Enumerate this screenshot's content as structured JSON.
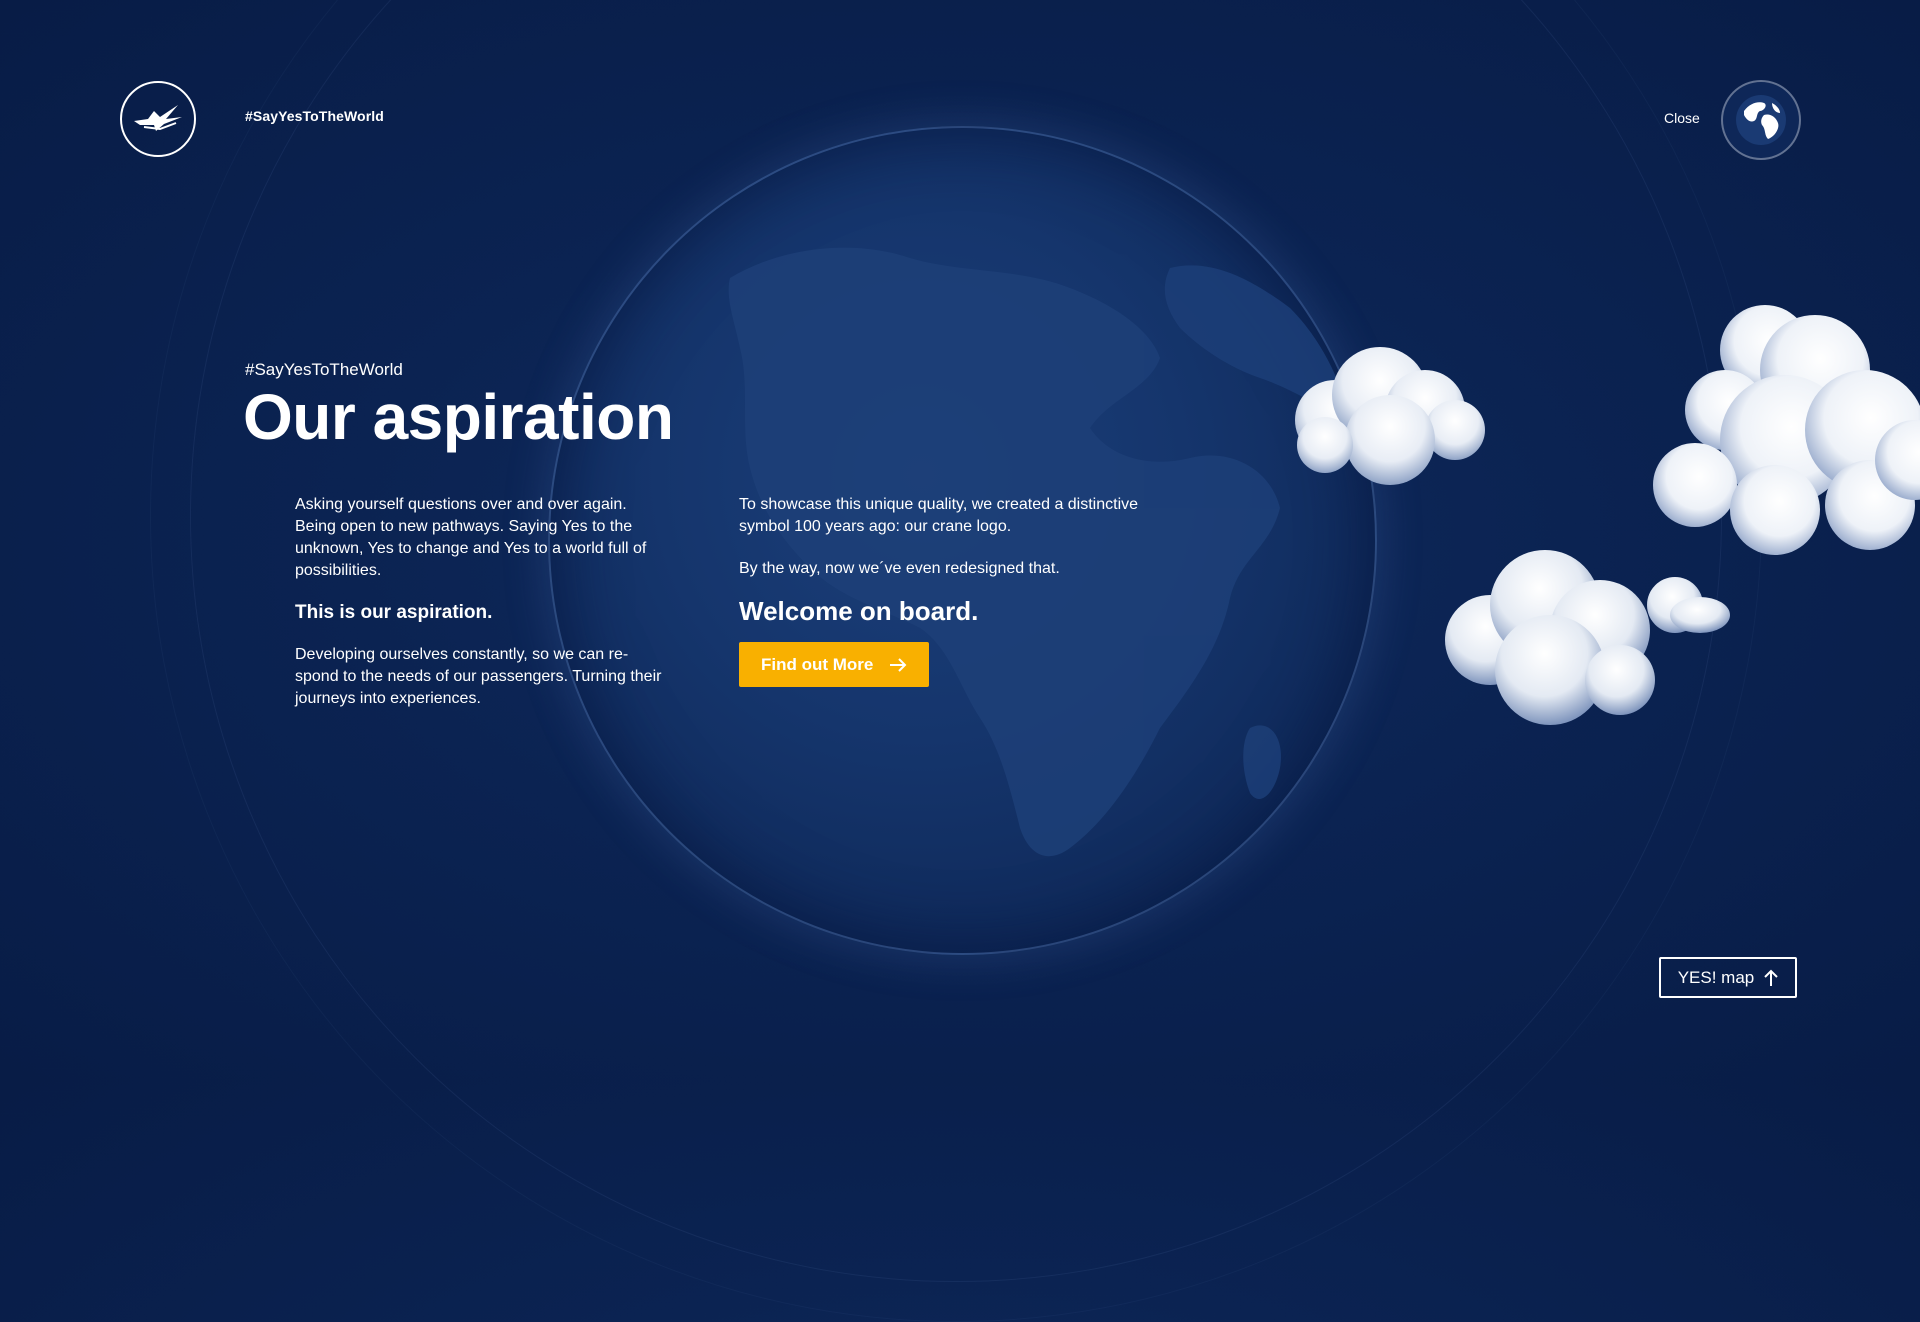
{
  "header": {
    "hashtag": "#SayYesToTheWorld",
    "close_label": "Close"
  },
  "hero": {
    "eyebrow": "#SayYesToTheWorld",
    "title": "Our aspiration"
  },
  "column_left": {
    "paragraph1": "Asking yourself questions over and over again. Being open to new pathways.  Saying Yes to the unknown, Yes to change and Yes to a world full of possibilities.",
    "emphasis": "This is our aspiration.",
    "paragraph2": "Developing ourselves constantly, so we can re-spond to the needs of our passengers.  Turning their journeys into experiences."
  },
  "column_right": {
    "paragraph1": "To showcase this unique quality, we created a distinctive symbol 100 years ago: our crane logo.",
    "paragraph2": "By the way, now we´ve even redesigned that.",
    "welcome": "Welcome on board.",
    "cta_label": "Find out More"
  },
  "map_button": {
    "label": "YES! map"
  },
  "icons": [
    "crane-logo-icon",
    "globe-icon",
    "arrow-right-icon",
    "arrow-up-icon"
  ],
  "colors": {
    "background": "#0b2352",
    "accent": "#f9b000",
    "text": "#ffffff"
  }
}
